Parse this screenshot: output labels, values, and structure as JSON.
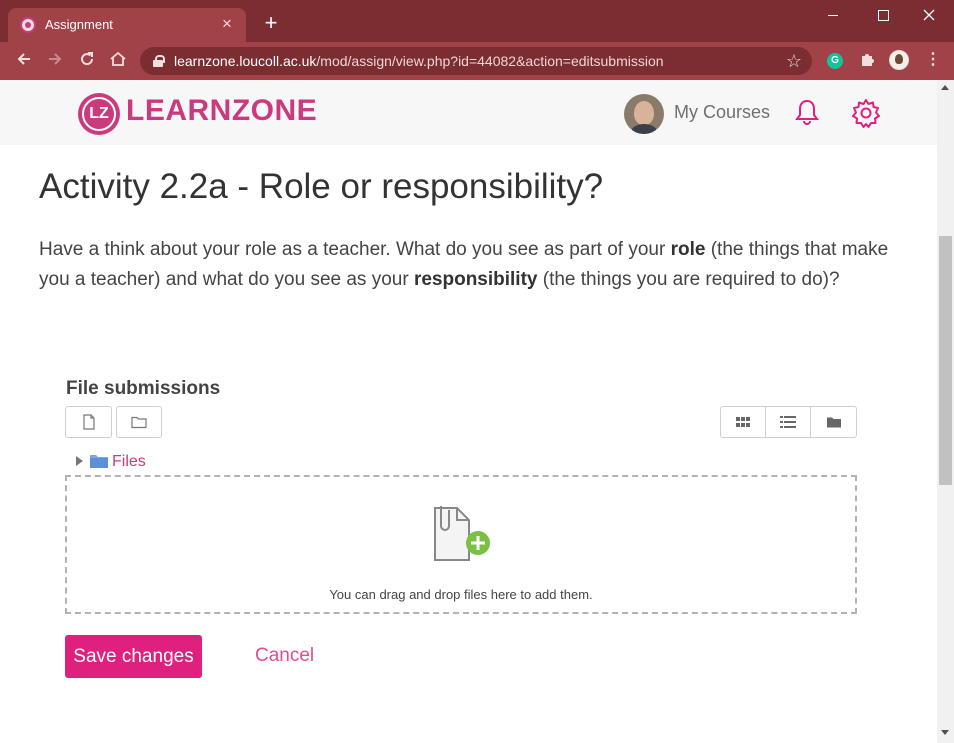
{
  "browser": {
    "tab_title": "Assignment",
    "tab_close": "×",
    "new_tab": "+",
    "url_host": "learnzone.loucoll.ac.uk",
    "url_path": "/mod/assign/view.php?id=44082&action=editsubmission",
    "grammarly_label": "G"
  },
  "header": {
    "logo_text": "LZ",
    "brand": "LEARNZONE",
    "my_courses": "My Courses"
  },
  "page": {
    "title": "Activity 2.2a - Role or responsibility?",
    "intro_part1": "Have a think about your role as a teacher. What do you see as part of your ",
    "intro_bold1": "role",
    "intro_part2": " (the things that make you a teacher) and what do you see as your ",
    "intro_bold2": "responsibility",
    "intro_part3": " (the things you are required to do)?"
  },
  "filepicker": {
    "section_label": "File submissions",
    "tree_folder": "Files",
    "drop_text": "You can drag and drop files here to add them."
  },
  "actions": {
    "save": "Save changes",
    "cancel": "Cancel"
  },
  "colors": {
    "brand": "#c93b7e",
    "save_button": "#e0207f",
    "browser_frame": "#7b2d32"
  }
}
